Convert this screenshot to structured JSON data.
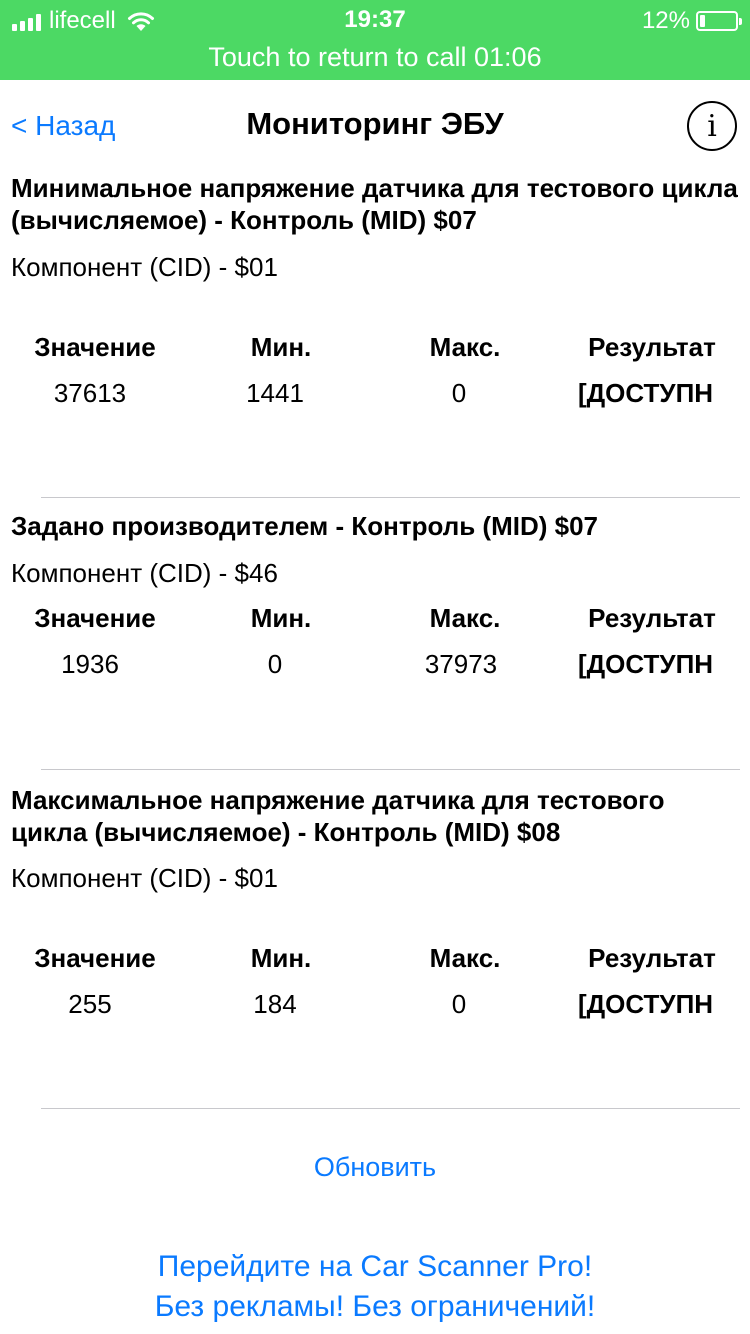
{
  "status_bar": {
    "carrier": "lifecell",
    "time": "19:37",
    "battery": "12%",
    "call_banner": "Touch to return to call 01:06"
  },
  "nav": {
    "back_label": "< Назад",
    "title": "Мониторинг ЭБУ",
    "info_label": "i"
  },
  "columns": {
    "value": "Значение",
    "min": "Мин.",
    "max": "Макс.",
    "result": "Результат"
  },
  "tests": [
    {
      "title": "Минимальное напряжение датчика для тестового цикла (вычисляемое) - Контроль (MID) $07",
      "component": "Компонент (CID) - $01",
      "value": "37613",
      "min": "1441",
      "max": "0",
      "result": "[ДОСТУПН"
    },
    {
      "title": "Задано производителем - Контроль (MID) $07",
      "component": "Компонент (CID) - $46",
      "value": "1936",
      "min": "0",
      "max": "37973",
      "result": "[ДОСТУПН"
    },
    {
      "title": "Максимальное напряжение датчика для тестового цикла (вычисляемое) - Контроль (MID) $08",
      "component": "Компонент (CID) - $01",
      "value": "255",
      "min": "184",
      "max": "0",
      "result": "[ДОСТУПН"
    }
  ],
  "refresh_label": "Обновить",
  "promo": {
    "line1": "Перейдите на Car Scanner Pro!",
    "line2": "Без рекламы! Без ограничений!"
  },
  "colors": {
    "status_green": "#4cd964",
    "link_blue": "#0a7aff"
  }
}
